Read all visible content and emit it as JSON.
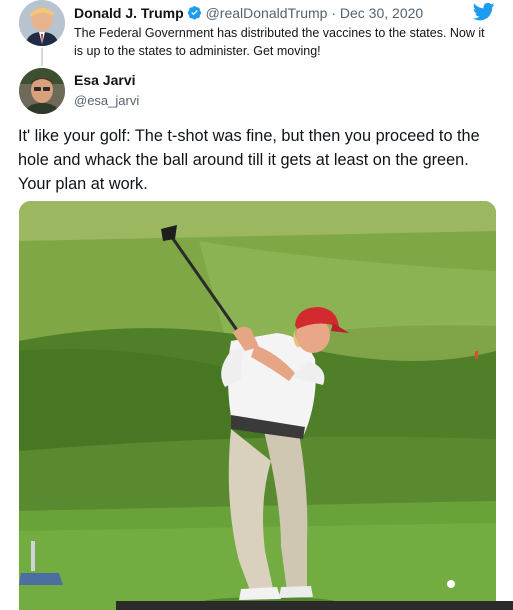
{
  "quoted_tweet": {
    "author_name": "Donald J. Trump",
    "handle": "@realDonaldTrump",
    "separator": "·",
    "date": "Dec 30, 2020",
    "text": "The Federal Government has distributed the vaccines to the states. Now it is up to the states to administer. Get moving!",
    "verified": true,
    "avatar_icon": "profile-photo"
  },
  "reply": {
    "author_name": "Esa Jarvi",
    "handle": "@esa_jarvi",
    "avatar_icon": "profile-photo",
    "text": "It' like your golf: The t-shot was fine, but then you proceed to the hole and whack the ball around till it gets at least on the green. Your plan at work.",
    "media": {
      "type": "photo",
      "subject": "golfer-swinging-driver"
    }
  },
  "brand": {
    "icon": "twitter-bird-icon",
    "color": "#1d9bf0"
  },
  "colors": {
    "verified": "#1d9bf0",
    "secondary_text": "#536471",
    "primary_text": "#0f1419"
  }
}
